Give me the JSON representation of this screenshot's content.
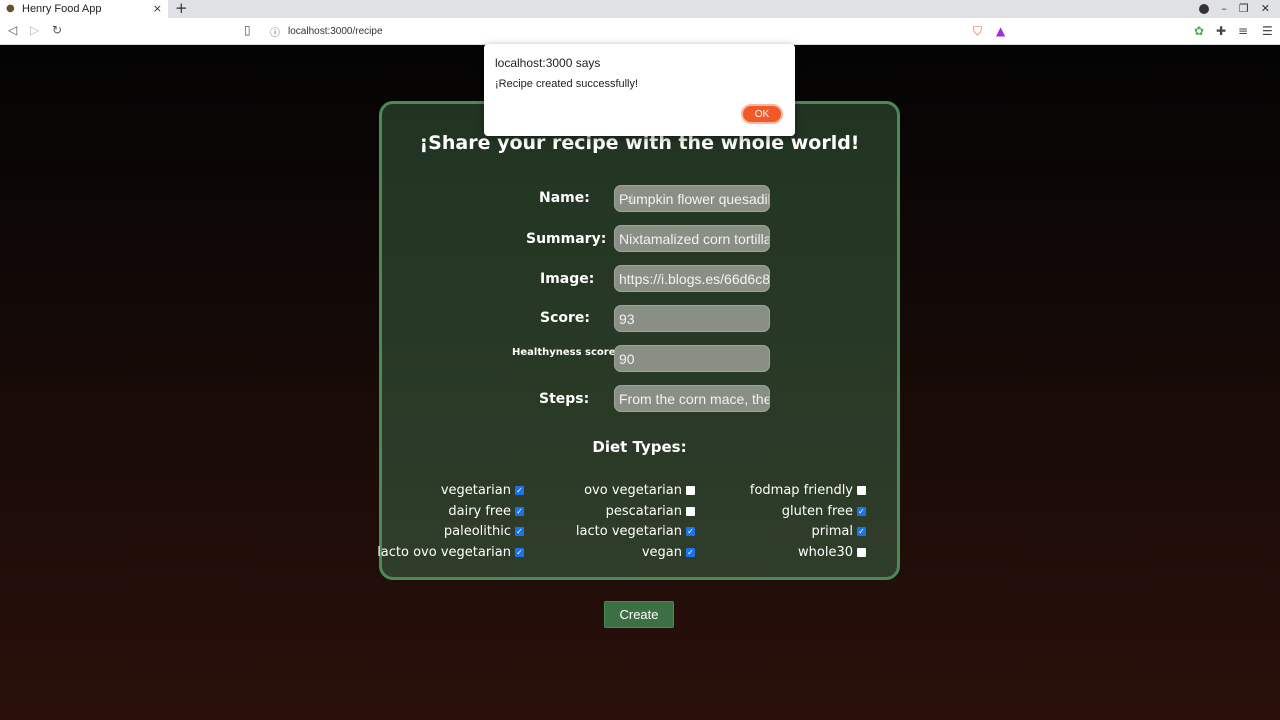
{
  "browser": {
    "tab_title": "Henry Food App",
    "tab_close": "×",
    "new_tab": "+",
    "url": "localhost:3000/recipe"
  },
  "alert": {
    "origin": "localhost:3000 says",
    "message": "¡Recipe created successfully!",
    "ok_label": "OK"
  },
  "form": {
    "title": "¡Share your recipe with the whole world!",
    "name_label": "Name:",
    "name_value": "Pumpkin flower quesadilla",
    "summary_label": "Summary:",
    "summary_value": "Nixtamalized corn tortilla",
    "image_label": "Image:",
    "image_value": "https://i.blogs.es/66d6c8",
    "score_label": "Score:",
    "score_value": "93",
    "health_label": "Healthyness score:",
    "health_value": "90",
    "steps_label": "Steps:",
    "steps_value": "From the corn mace, the",
    "diet_title": "Diet Types:",
    "diets": [
      {
        "label": "vegetarian",
        "checked": true
      },
      {
        "label": "ovo vegetarian",
        "checked": false
      },
      {
        "label": "fodmap friendly",
        "checked": false
      },
      {
        "label": "dairy free",
        "checked": true
      },
      {
        "label": "pescatarian",
        "checked": false
      },
      {
        "label": "gluten free",
        "checked": true
      },
      {
        "label": "paleolithic",
        "checked": true
      },
      {
        "label": "lacto vegetarian",
        "checked": true
      },
      {
        "label": "primal",
        "checked": true
      },
      {
        "label": "lacto ovo vegetarian",
        "checked": true
      },
      {
        "label": "vegan",
        "checked": true
      },
      {
        "label": "whole30",
        "checked": false
      }
    ],
    "create_label": "Create"
  },
  "colors": {
    "card_border": "#4b8a56",
    "ok_button": "#f05a28",
    "checkbox_checked": "#1a73e8"
  }
}
